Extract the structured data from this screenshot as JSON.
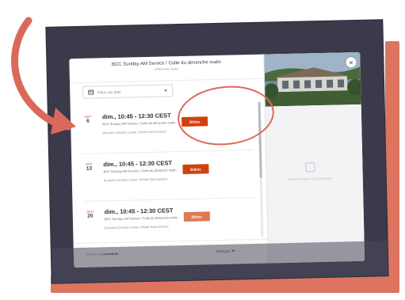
{
  "modal": {
    "title": "BCC Sunday AM Service / Culte du dimanche matin",
    "subtitle": "Différentes dates"
  },
  "filter": {
    "label": "Filtrer par date",
    "clear": "×"
  },
  "events": [
    {
      "month": "SEPT",
      "day": "6",
      "time": "dim., 10:45 - 12:30 CEST",
      "name": "BCC Sunday AM Service / Culte du dimanche matin",
      "location": "Brussels Christian Center, Rhode-Saint-Genèse",
      "button": "Billets"
    },
    {
      "month": "SEPT",
      "day": "13",
      "time": "dim., 10:45 - 12:30 CEST",
      "name": "BCC Sunday AM Service / Culte du dimanche matin",
      "location": "Brussels Christian Center, Rhode-Saint-Genèse",
      "button": "Billets"
    },
    {
      "month": "SEPT",
      "day": "20",
      "time": "dim., 10:45 - 12:30 CEST",
      "name": "BCC Sunday AM Service / Culte du dimanche matin",
      "location": "Brussels Christian Center, Rhode-Saint-Genèse",
      "button": "Billets"
    }
  ],
  "footer": {
    "powered_prefix": "Réalisé par",
    "powered_brand": "eventbrite",
    "language": "Français"
  },
  "right_panel": {
    "close": "×",
    "empty_label": "SÉLECTIONNER UN ÉVÉNEMENT"
  },
  "colors": {
    "accent": "#d1410c",
    "annotation": "#d9695a",
    "frame": "#3b3a4a",
    "backdrop": "#dd7460"
  }
}
